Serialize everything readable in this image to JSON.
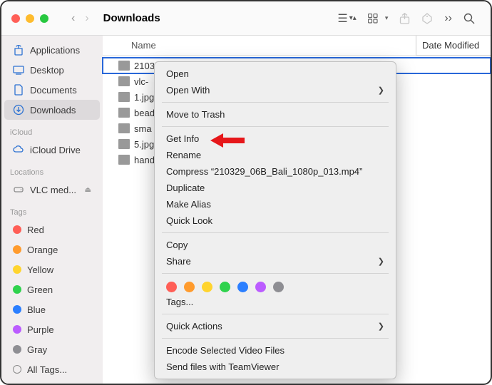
{
  "title": "Downloads",
  "traffic": {
    "close": "#ff5f57",
    "min": "#febc2e",
    "max": "#28c840"
  },
  "sidebar": {
    "fav": [
      {
        "icon": "applications",
        "label": "Applications"
      },
      {
        "icon": "desktop",
        "label": "Desktop"
      },
      {
        "icon": "documents",
        "label": "Documents"
      },
      {
        "icon": "downloads",
        "label": "Downloads",
        "selected": true
      }
    ],
    "icloud": {
      "head": "iCloud",
      "items": [
        {
          "icon": "cloud",
          "label": "iCloud Drive"
        }
      ]
    },
    "locations": {
      "head": "Locations",
      "items": [
        {
          "icon": "disk",
          "label": "VLC med...",
          "eject": true
        }
      ]
    },
    "tags": {
      "head": "Tags",
      "items": [
        {
          "color": "#ff5e56",
          "label": "Red"
        },
        {
          "color": "#ff9b2d",
          "label": "Orange"
        },
        {
          "color": "#ffd42e",
          "label": "Yellow"
        },
        {
          "color": "#2fd24d",
          "label": "Green"
        },
        {
          "color": "#2b7fff",
          "label": "Blue"
        },
        {
          "color": "#bb5cff",
          "label": "Purple"
        },
        {
          "color": "#8e8e93",
          "label": "Gray"
        },
        {
          "outline": true,
          "label": "All Tags..."
        }
      ]
    }
  },
  "columns": {
    "name": "Name",
    "modified": "Date Modified"
  },
  "files": [
    {
      "name": "2103",
      "selected": true
    },
    {
      "name": "vlc-"
    },
    {
      "name": "1.jpg"
    },
    {
      "name": "bead"
    },
    {
      "name": "sma"
    },
    {
      "name": "5.jpg"
    },
    {
      "name": "hand"
    }
  ],
  "context": {
    "groups": [
      [
        {
          "label": "Open"
        },
        {
          "label": "Open With",
          "sub": true
        }
      ],
      [
        {
          "label": "Move to Trash"
        }
      ],
      [
        {
          "label": "Get Info"
        },
        {
          "label": "Rename"
        },
        {
          "label": "Compress “210329_06B_Bali_1080p_013.mp4”"
        },
        {
          "label": "Duplicate"
        },
        {
          "label": "Make Alias"
        },
        {
          "label": "Quick Look"
        }
      ],
      [
        {
          "label": "Copy"
        },
        {
          "label": "Share",
          "sub": true
        }
      ],
      "colors",
      [
        {
          "label": "Quick Actions",
          "sub": true
        }
      ],
      [
        {
          "label": "Encode Selected Video Files"
        },
        {
          "label": "Send files with TeamViewer"
        }
      ]
    ],
    "tagsLabel": "Tags...",
    "colors": [
      "#ff5e56",
      "#ff9b2d",
      "#ffd42e",
      "#2fd24d",
      "#2b7fff",
      "#bb5cff",
      "#8e8e93"
    ]
  }
}
